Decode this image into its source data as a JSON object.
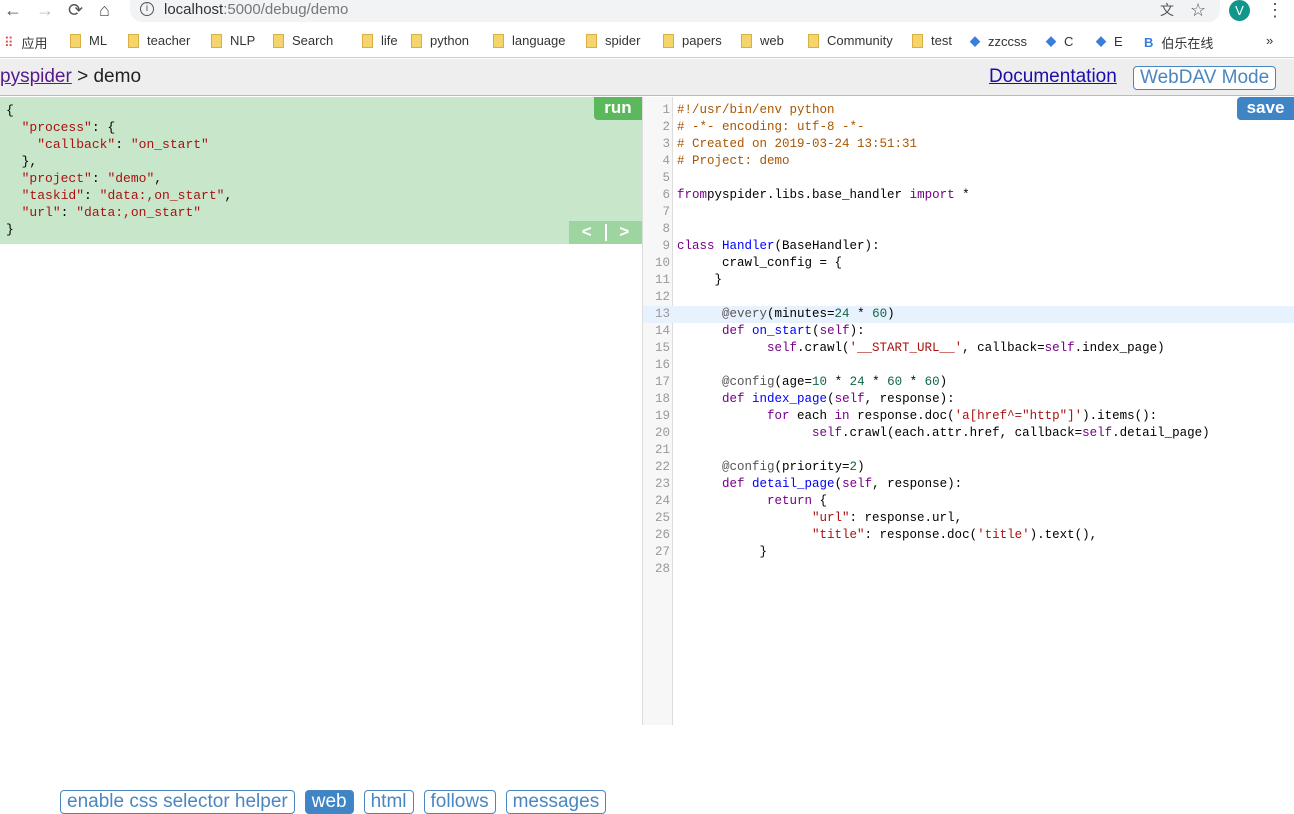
{
  "browser": {
    "url_host": "localhost",
    "url_rest": ":5000/debug/demo",
    "profile_initial": "V",
    "bookmarks": [
      "应用",
      "ML",
      "teacher",
      "NLP",
      "Search",
      "life",
      "python",
      "language",
      "spider",
      "papers",
      "web",
      "Community",
      "test",
      "zzccss",
      "C",
      "E",
      "伯乐在线"
    ]
  },
  "header": {
    "home_link": "pyspider",
    "separator": " > ",
    "project": "demo",
    "documentation": "Documentation",
    "webdav": "WebDAV Mode"
  },
  "task_panel": {
    "json_text": "{\n  \"process\": {\n    \"callback\": \"on_start\"\n  },\n  \"project\": \"demo\",\n  \"taskid\": \"data:,on_start\",\n  \"url\": \"data:,on_start\"\n}",
    "run_label": "run",
    "prev_label": "<",
    "next_label": ">"
  },
  "bottom_tabs": [
    {
      "label": "enable css selector helper",
      "active": false
    },
    {
      "label": "web",
      "active": true
    },
    {
      "label": "html",
      "active": false
    },
    {
      "label": "follows",
      "active": false
    },
    {
      "label": "messages",
      "active": false
    }
  ],
  "editor": {
    "save_label": "save",
    "highlighted_line": 13,
    "lines": [
      [
        [
          "c",
          "#!/usr/bin/env python"
        ]
      ],
      [
        [
          "c",
          "# -*- encoding: utf-8 -*-"
        ]
      ],
      [
        [
          "c",
          "# Created on 2019-03-24 13:51:31"
        ]
      ],
      [
        [
          "c",
          "# Project: demo"
        ]
      ],
      [],
      [
        [
          "k",
          "from"
        ],
        [
          "",
          "pyspider.libs.base_handler "
        ],
        [
          "k",
          "import"
        ],
        [
          "",
          " *"
        ]
      ],
      [],
      [],
      [
        [
          "k",
          "class"
        ],
        [
          "",
          " "
        ],
        [
          "d",
          "Handler"
        ],
        [
          "",
          "(BaseHandler):"
        ]
      ],
      [
        [
          "",
          "      crawl_config = {"
        ]
      ],
      [
        [
          "",
          "     }"
        ]
      ],
      [],
      [
        [
          "",
          "      "
        ],
        [
          "m",
          "@every"
        ],
        [
          "",
          "(minutes="
        ],
        [
          "n",
          "24"
        ],
        [
          "",
          " * "
        ],
        [
          "n",
          "60"
        ],
        [
          "",
          ")"
        ]
      ],
      [
        [
          "",
          "      "
        ],
        [
          "k",
          "def"
        ],
        [
          "",
          " "
        ],
        [
          "d",
          "on_start"
        ],
        [
          "",
          "("
        ],
        [
          "v",
          "self"
        ],
        [
          "",
          "):"
        ]
      ],
      [
        [
          "",
          "            "
        ],
        [
          "v",
          "self"
        ],
        [
          "",
          ".crawl("
        ],
        [
          "s",
          "'__START_URL__'"
        ],
        [
          "",
          ", callback="
        ],
        [
          "v",
          "self"
        ],
        [
          "",
          ".index_page)"
        ]
      ],
      [],
      [
        [
          "",
          "      "
        ],
        [
          "m",
          "@config"
        ],
        [
          "",
          "(age="
        ],
        [
          "n",
          "10"
        ],
        [
          "",
          " * "
        ],
        [
          "n",
          "24"
        ],
        [
          "",
          " * "
        ],
        [
          "n",
          "60"
        ],
        [
          "",
          " * "
        ],
        [
          "n",
          "60"
        ],
        [
          "",
          ")"
        ]
      ],
      [
        [
          "",
          "      "
        ],
        [
          "k",
          "def"
        ],
        [
          "",
          " "
        ],
        [
          "d",
          "index_page"
        ],
        [
          "",
          "("
        ],
        [
          "v",
          "self"
        ],
        [
          "",
          ", response):"
        ]
      ],
      [
        [
          "",
          "            "
        ],
        [
          "k",
          "for"
        ],
        [
          "",
          " each "
        ],
        [
          "k",
          "in"
        ],
        [
          "",
          " response.doc("
        ],
        [
          "s",
          "'a[href^=\"http\"]'"
        ],
        [
          "",
          ").items():"
        ]
      ],
      [
        [
          "",
          "                  "
        ],
        [
          "v",
          "self"
        ],
        [
          "",
          ".crawl(each.attr.href, callback="
        ],
        [
          "v",
          "self"
        ],
        [
          "",
          ".detail_page)"
        ]
      ],
      [],
      [
        [
          "",
          "      "
        ],
        [
          "m",
          "@config"
        ],
        [
          "",
          "(priority="
        ],
        [
          "n",
          "2"
        ],
        [
          "",
          ")"
        ]
      ],
      [
        [
          "",
          "      "
        ],
        [
          "k",
          "def"
        ],
        [
          "",
          " "
        ],
        [
          "d",
          "detail_page"
        ],
        [
          "",
          "("
        ],
        [
          "v",
          "self"
        ],
        [
          "",
          ", response):"
        ]
      ],
      [
        [
          "",
          "            "
        ],
        [
          "k",
          "return"
        ],
        [
          "",
          " {"
        ]
      ],
      [
        [
          "",
          "                  "
        ],
        [
          "s",
          "\"url\""
        ],
        [
          "",
          ": response.url,"
        ]
      ],
      [
        [
          "",
          "                  "
        ],
        [
          "s",
          "\"title\""
        ],
        [
          "",
          ": response.doc("
        ],
        [
          "s",
          "'title'"
        ],
        [
          "",
          ").text(),"
        ]
      ],
      [
        [
          "",
          "           }"
        ]
      ],
      []
    ]
  }
}
